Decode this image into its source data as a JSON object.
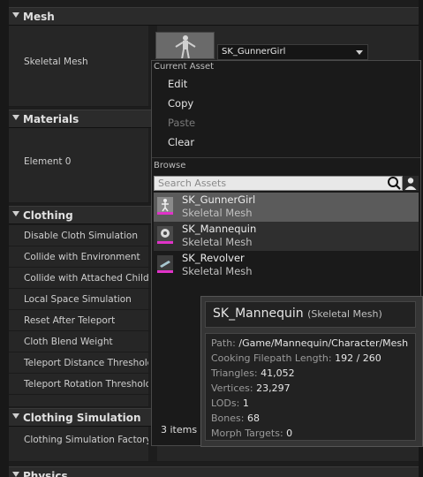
{
  "categories": {
    "mesh": "Mesh",
    "materials": "Materials",
    "clothing": "Clothing",
    "clothing_simulation": "Clothing Simulation",
    "physics": "Physics"
  },
  "properties": {
    "skeletal_mesh": "Skeletal Mesh",
    "element0": "Element 0",
    "clothing": [
      "Disable Cloth Simulation",
      "Collide with Environment",
      "Collide with Attached Childre",
      "Local Space Simulation",
      "Reset After Teleport",
      "Cloth Blend Weight",
      "Teleport Distance Threshold",
      "Teleport Rotation Threshold"
    ],
    "clothing_simulation_factory": "Clothing Simulation Factory"
  },
  "combo": {
    "value": "SK_GunnerGirl"
  },
  "menu": {
    "current_asset_header": "Current Asset",
    "edit": "Edit",
    "copy": "Copy",
    "paste": "Paste",
    "clear": "Clear",
    "browse_header": "Browse",
    "search_placeholder": "Search Assets",
    "assets": [
      {
        "name": "SK_GunnerGirl",
        "type": "Skeletal Mesh"
      },
      {
        "name": "SK_Mannequin",
        "type": "Skeletal Mesh"
      },
      {
        "name": "SK_Revolver",
        "type": "Skeletal Mesh"
      }
    ],
    "item_count": "3 items ("
  },
  "tooltip": {
    "title": "SK_Mannequin",
    "subtitle": "(Skeletal Mesh)",
    "lines": [
      {
        "label": "Path:",
        "value": "/Game/Mannequin/Character/Mesh"
      },
      {
        "label": "Cooking Filepath Length:",
        "value": "192 / 260"
      },
      {
        "label": "Triangles:",
        "value": "41,052"
      },
      {
        "label": "Vertices:",
        "value": "23,297"
      },
      {
        "label": "LODs:",
        "value": "1"
      },
      {
        "label": "Bones:",
        "value": "68"
      },
      {
        "label": "Morph Targets:",
        "value": "0"
      }
    ]
  },
  "colors": {
    "selected_row": "#5b5b5b",
    "asset_type_underline": "#e033c8",
    "search_bg": "#e8e8e8"
  }
}
